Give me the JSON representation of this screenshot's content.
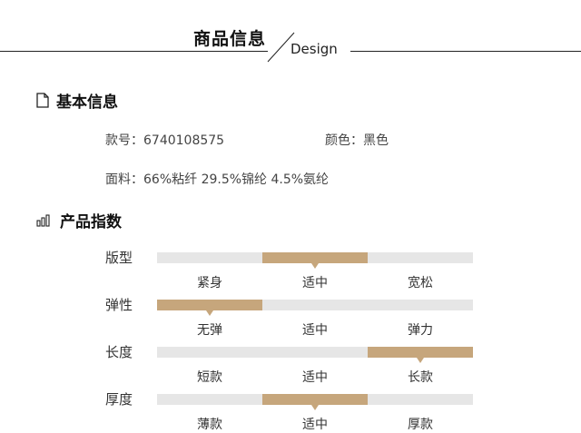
{
  "header": {
    "title": "商品信息",
    "subtitle": "Design"
  },
  "basic": {
    "title": "基本信息",
    "icon": "document-icon",
    "sku_label": "款号：",
    "sku_value": "6740108575",
    "color_label": "颜色：",
    "color_value": "黑色",
    "fabric_label": "面料：",
    "fabric_value": "66%粘纤 29.5%锦纶 4.5%氨纶"
  },
  "index": {
    "title": "产品指数",
    "icon": "bar-chart-icon",
    "rows": [
      {
        "name": "版型",
        "options": [
          "紧身",
          "适中",
          "宽松"
        ],
        "selected": 1
      },
      {
        "name": "弹性",
        "options": [
          "无弹",
          "适中",
          "弹力"
        ],
        "selected": 0
      },
      {
        "name": "长度",
        "options": [
          "短款",
          "适中",
          "长款"
        ],
        "selected": 2
      },
      {
        "name": "厚度",
        "options": [
          "薄款",
          "适中",
          "厚款"
        ],
        "selected": 1
      }
    ]
  },
  "colors": {
    "accent": "#c6a67c",
    "track": "#e6e6e6",
    "text": "#333333"
  }
}
